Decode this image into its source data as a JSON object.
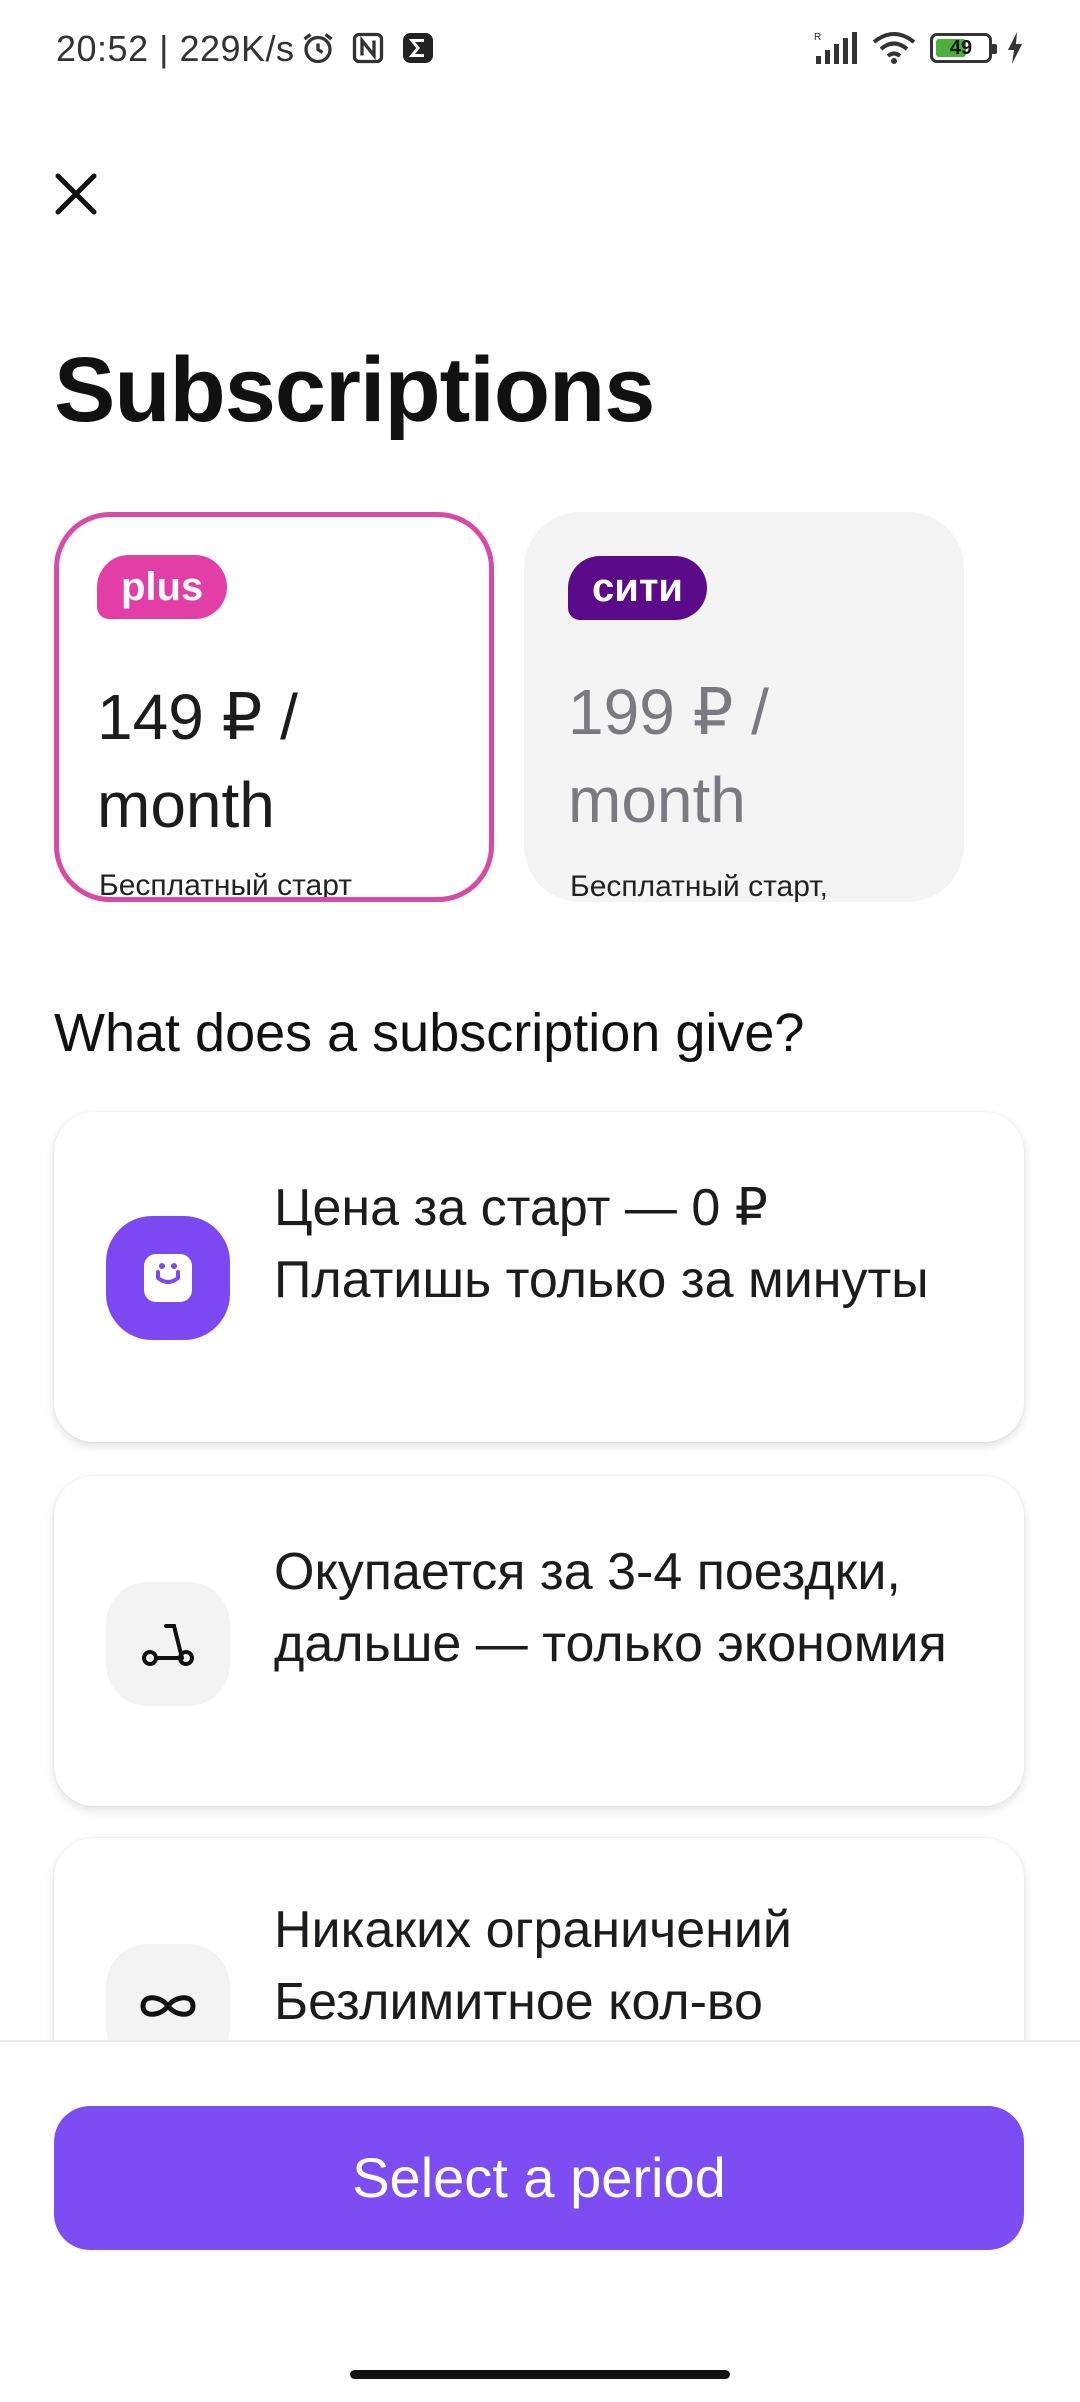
{
  "status_bar": {
    "text": "20:52 | 229K/s",
    "battery": "49",
    "icons": [
      "alarm-icon",
      "nfc-icon",
      "sigma-icon",
      "signal-icon",
      "wifi-icon",
      "battery-icon",
      "charging-icon"
    ]
  },
  "header": {
    "title": "Subscriptions"
  },
  "plans": [
    {
      "badge": "plus",
      "price": "149 ₽ / month",
      "note": "Бесплатный старт",
      "selected": true,
      "accent": "#e23ea6"
    },
    {
      "badge": "сити",
      "price": "199 ₽ / month",
      "note": "Бесплатный старт,",
      "selected": false,
      "accent": "#5b0a8a"
    }
  ],
  "benefits_title": "What does a subscription give?",
  "benefits": [
    {
      "icon": "smile-box-icon",
      "text": "Цена за старт — 0 ₽ Платишь только за минуты"
    },
    {
      "icon": "scooter-icon",
      "text": "Окупается за 3-4 поездки, дальше — только экономия"
    },
    {
      "icon": "infinity-icon",
      "text": "Никаких ограничений Безлимитное кол-во"
    }
  ],
  "cta": {
    "label": "Select a period",
    "color": "#7c4df3"
  }
}
